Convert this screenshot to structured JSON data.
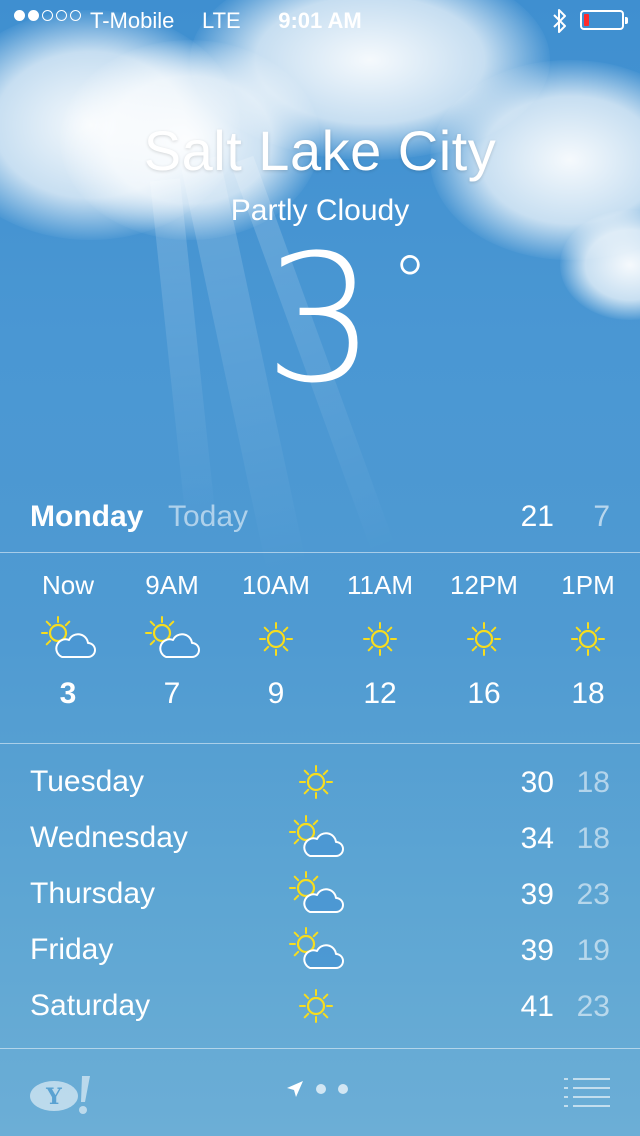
{
  "status_bar": {
    "signal_dots": [
      true,
      true,
      false,
      false,
      false
    ],
    "carrier": "T-Mobile",
    "network": "LTE",
    "time": "9:01 AM",
    "battery_level": 0.15
  },
  "location": {
    "city": "Salt Lake City",
    "condition": "Partly Cloudy",
    "temperature": "3",
    "degree_symbol": "°"
  },
  "today": {
    "day": "Monday",
    "label": "Today",
    "high": "21",
    "low": "7"
  },
  "hourly": [
    {
      "label": "Now",
      "icon": "partly-cloudy-icon",
      "temp": "3"
    },
    {
      "label": "9AM",
      "icon": "partly-cloudy-icon",
      "temp": "7"
    },
    {
      "label": "10AM",
      "icon": "sun-icon",
      "temp": "9"
    },
    {
      "label": "11AM",
      "icon": "sun-icon",
      "temp": "12"
    },
    {
      "label": "12PM",
      "icon": "sun-icon",
      "temp": "16"
    },
    {
      "label": "1PM",
      "icon": "sun-icon",
      "temp": "18"
    }
  ],
  "daily": [
    {
      "day": "Tuesday",
      "icon": "sun-icon",
      "high": "30",
      "low": "18"
    },
    {
      "day": "Wednesday",
      "icon": "partly-cloudy-icon",
      "high": "34",
      "low": "18"
    },
    {
      "day": "Thursday",
      "icon": "partly-cloudy-icon",
      "high": "39",
      "low": "23"
    },
    {
      "day": "Friday",
      "icon": "partly-cloudy-icon",
      "high": "39",
      "low": "19"
    },
    {
      "day": "Saturday",
      "icon": "sun-icon",
      "high": "41",
      "low": "23"
    }
  ],
  "footer": {
    "logo": "Y!",
    "pages": 3,
    "current_page": 0
  },
  "colors": {
    "sky_top": "#3f8fd0",
    "sky_bottom": "#6caed6",
    "icon_yellow": "#f7dd1e",
    "battery_red": "#ff2b2b"
  }
}
